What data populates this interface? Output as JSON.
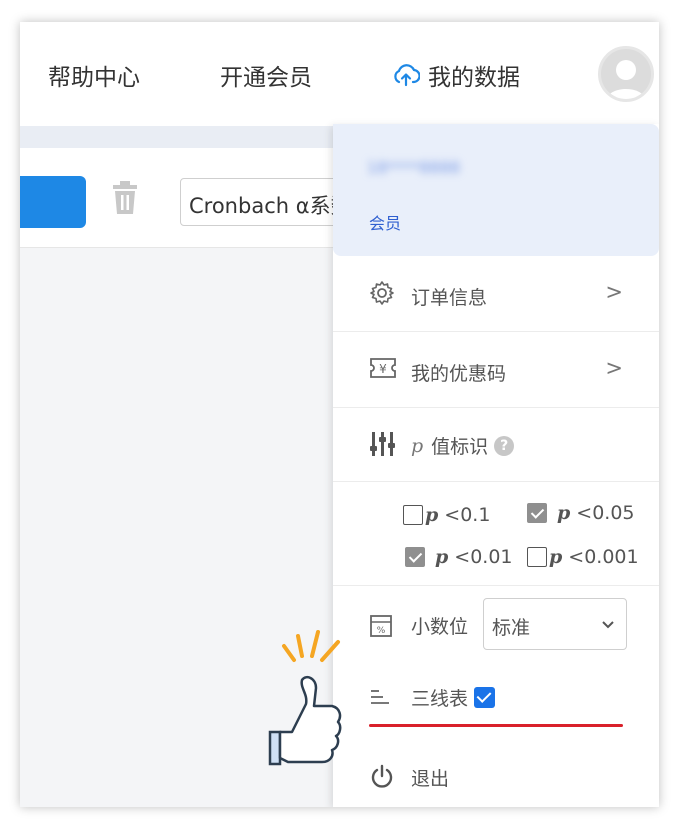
{
  "header": {
    "help_label": "帮助中心",
    "vip_label": "开通会员",
    "data_label": "我的数据"
  },
  "toolbar": {
    "method_value": "Cronbach α系数"
  },
  "menu": {
    "account_text": "18****8888",
    "member_label": "会员",
    "items": [
      {
        "label": "订单信息",
        "icon": "gear-icon",
        "chevron": ">"
      },
      {
        "label": "我的优惠码",
        "icon": "coupon-icon",
        "chevron": ">"
      }
    ],
    "pvalue": {
      "p_symbol": "p",
      "label": "值标识",
      "help": "?",
      "options": [
        {
          "p": "p",
          "text": "<0.1",
          "checked": false
        },
        {
          "p": "p",
          "text": "<0.05",
          "checked": true
        },
        {
          "p": "p",
          "text": "<0.01",
          "checked": true
        },
        {
          "p": "p",
          "text": "<0.001",
          "checked": false
        }
      ]
    },
    "decimal": {
      "label": "小数位",
      "value": "标准"
    },
    "three_line": {
      "label": "三线表",
      "checked": true
    },
    "logout_label": "退出"
  },
  "colors": {
    "accent": "#1e88e5",
    "highlight_line": "#d9202a",
    "menu_header_bg": "#e9effa"
  }
}
